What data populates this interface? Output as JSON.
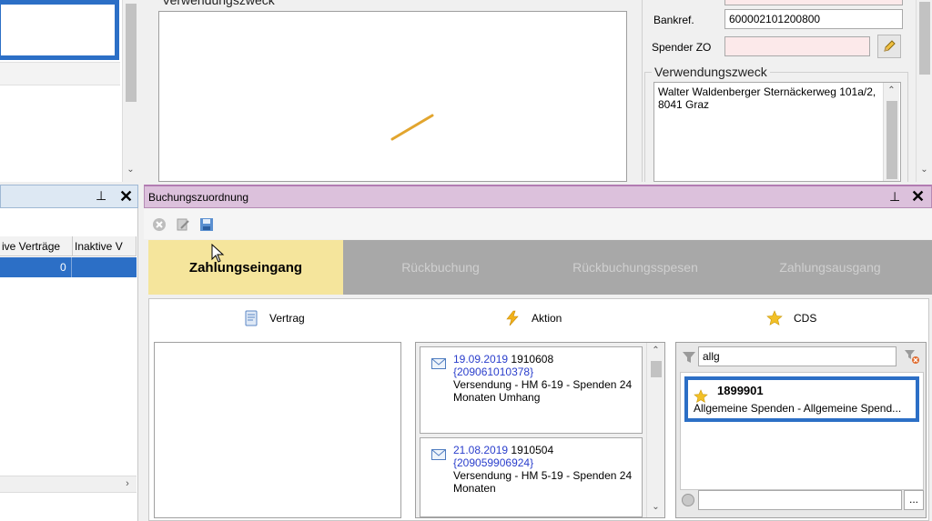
{
  "top_middle": {
    "group_title": "Verwendungszweck"
  },
  "top_right": {
    "bankref_label": "Bankref.",
    "bankref_value": "600002101200800",
    "spender_zo_label": "Spender ZO",
    "spender_zo_value": "",
    "group_title": "Verwendungszweck",
    "address_line1": "Walter Waldenberger Sternäckerweg 101a/2,",
    "address_line2": "8041 Graz"
  },
  "left_panel": {
    "columns": [
      "ive Verträge",
      "Inaktive V"
    ],
    "selected_row_value": "0"
  },
  "main_panel": {
    "title": "Buchungszuordnung",
    "tabs": [
      {
        "label": "Zahlungseingang",
        "active": true
      },
      {
        "label": "Rückbuchung",
        "active": false
      },
      {
        "label": "Rückbuchungsspesen",
        "active": false
      },
      {
        "label": "Zahlungsausgang",
        "active": false
      }
    ],
    "columns": {
      "vertrag": "Vertrag",
      "aktion": "Aktion",
      "cds": "CDS"
    }
  },
  "aktion_items": [
    {
      "date": "19.09.2019",
      "number": "1910608",
      "ref": "{209061010378}",
      "desc_line1": "Versendung - HM 6-19 - Spenden 24",
      "desc_line2": "Monaten Umhang"
    },
    {
      "date": "21.08.2019",
      "number": "1910504",
      "ref": "{209059906924}",
      "desc_line1": "Versendung - HM 5-19 - Spenden 24",
      "desc_line2": "Monaten"
    }
  ],
  "cds": {
    "filter_value": "allg",
    "result_id": "1899901",
    "result_desc": "Allgemeine Spenden - Allgemeine Spend...",
    "bottom_value": "",
    "dots_label": "..."
  },
  "colors": {
    "selection_blue": "#2c6fc6",
    "active_tab": "#f5e59c",
    "inactive_tab": "#a8a8a8",
    "title_bar_purple": "#dcc1dc",
    "link_blue": "#2a3ecc"
  }
}
